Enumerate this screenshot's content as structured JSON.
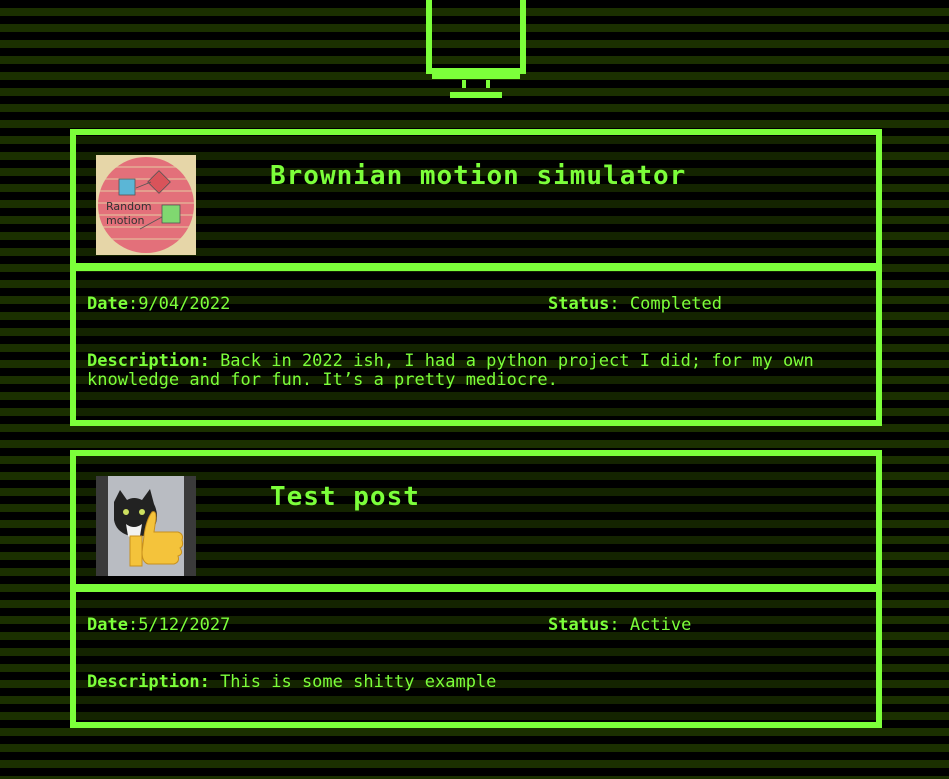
{
  "posts": [
    {
      "title": "Brownian motion simulator",
      "thumbnail_text_line1": "Random",
      "thumbnail_text_line2": "motion",
      "date_label": "Date",
      "date_value": ":9/04/2022",
      "status_label": "Status",
      "status_value": ": Completed",
      "description_label": "Description:",
      "description_text": " Back in 2022 ish, I had a python project I did; for my own knowledge and for fun. It’s a pretty mediocre."
    },
    {
      "title": "Test post",
      "thumbnail_icon": "thumbs-up-cat-image",
      "date_label": "Date",
      "date_value": ":5/12/2027",
      "status_label": "Status",
      "status_value": ": Active",
      "description_label": "Description:",
      "description_text": " This is some shitty example"
    }
  ],
  "header_icon": "monitor-icon",
  "colors": {
    "accent": "#7cff3a",
    "background": "#000000",
    "stripe": "#1b3000"
  }
}
